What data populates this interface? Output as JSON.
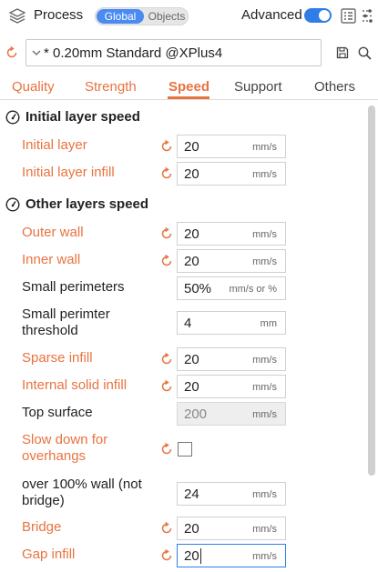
{
  "header": {
    "title": "Process",
    "seg_global": "Global",
    "seg_objects": "Objects",
    "advanced_label": "Advanced",
    "advanced_on": true
  },
  "preset": {
    "name": "* 0.20mm Standard @XPlus4"
  },
  "tabs": [
    "Quality",
    "Strength",
    "Speed",
    "Support",
    "Others"
  ],
  "active_tab": "Speed",
  "colors": {
    "modified": "#e8733f",
    "accent": "#2f7ee8",
    "global_segment": "#4a8af1"
  },
  "sections": {
    "initial": {
      "title": "Initial layer speed",
      "rows": [
        {
          "label": "Initial layer",
          "value": "20",
          "unit": "mm/s"
        },
        {
          "label": "Initial layer infill",
          "value": "20",
          "unit": "mm/s"
        }
      ]
    },
    "other": {
      "title": "Other layers speed",
      "rows": [
        {
          "label": "Outer wall",
          "value": "20",
          "unit": "mm/s"
        },
        {
          "label": "Inner wall",
          "value": "20",
          "unit": "mm/s"
        },
        {
          "label": "Small perimeters",
          "value": "50%",
          "unit": "mm/s or %"
        },
        {
          "label_line1": "Small perimter",
          "label_line2": "threshold",
          "value": "4",
          "unit": "mm"
        },
        {
          "label": "Sparse infill",
          "value": "20",
          "unit": "mm/s"
        },
        {
          "label": "Internal solid infill",
          "value": "20",
          "unit": "mm/s"
        },
        {
          "label": "Top surface",
          "value": "200",
          "unit": "mm/s"
        },
        {
          "label_line1": "Slow down for",
          "label_line2": "overhangs",
          "checked": false
        },
        {
          "label_line1": "over 100% wall (not",
          "label_line2": "bridge)",
          "value": "24",
          "unit": "mm/s"
        },
        {
          "label": "Bridge",
          "value": "20",
          "unit": "mm/s"
        },
        {
          "label": "Gap infill",
          "value": "20",
          "unit": "mm/s"
        }
      ]
    }
  }
}
